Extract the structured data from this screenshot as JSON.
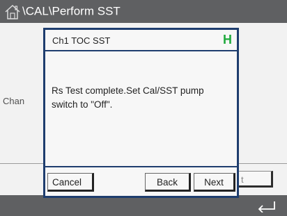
{
  "header": {
    "separator": "\\",
    "path": [
      "CAL",
      "Perform SST"
    ]
  },
  "background": {
    "channel_label": "Chan",
    "button_label": "t"
  },
  "dialog": {
    "title": "Ch1 TOC SST",
    "status_indicator": "H",
    "message": "Rs Test complete.Set Cal/SST pump switch to \"Off\".",
    "buttons": {
      "cancel": "Cancel",
      "back": "Back",
      "next": "Next"
    }
  },
  "icons": {
    "home": "home-icon",
    "back_arrow": "back-arrow-icon"
  },
  "colors": {
    "header_bg": "#5f6062",
    "dialog_border": "#1e3d6e",
    "status_green": "#1faa3d"
  }
}
